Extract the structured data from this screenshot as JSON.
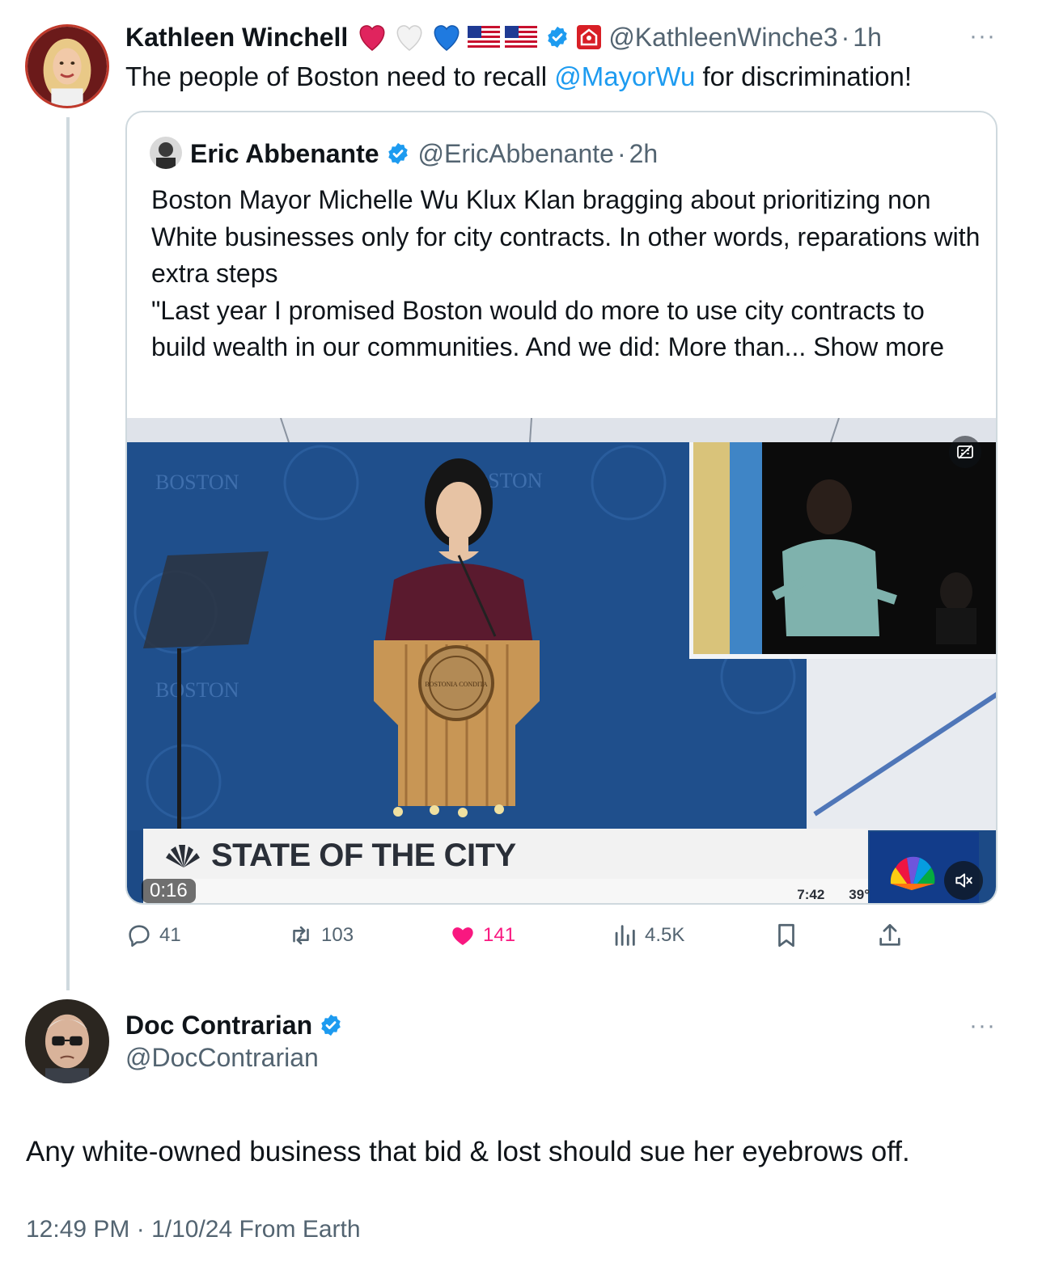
{
  "reply": {
    "name": "Kathleen Winchell",
    "handle": "@KathleenWinche3",
    "separator": "·",
    "time": "1h",
    "text_before": "The people of Boston need to recall ",
    "mention": "@MayorWu",
    "text_after": " for discrimination!",
    "more": "···"
  },
  "quote": {
    "name": "Eric Abbenante",
    "handle": "@EricAbbenante",
    "separator": "·",
    "time": "2h",
    "line1": "Boston Mayor Michelle Wu Klux Klan bragging about prioritizing non White businesses only for city contracts. In other words, reparations with extra steps",
    "line2": "\"Last year I promised Boston would do more to use city contracts to build wealth in our communities. And we did: More than...",
    "show_more": " Show more"
  },
  "video": {
    "chyron": "STATE OF THE CITY",
    "duration": "0:16",
    "clock": "7:42",
    "temperature": "39°",
    "podium_seal_text": "BOSTONIA CONDITA",
    "backdrop_text": "BOSTON"
  },
  "actions": {
    "replies": "41",
    "reposts": "103",
    "likes": "141",
    "views": "4.5K"
  },
  "main": {
    "name": "Doc Contrarian",
    "handle": "@DocContrarian",
    "text": "Any white-owned business that bid & lost should sue her eyebrows off.",
    "more": "···",
    "footer": "12:49 PM · 1/10/24 From Earth"
  },
  "colors": {
    "verified": "#1d9bf0",
    "link": "#1d9bf0",
    "like": "#f91880",
    "secondary_text": "#536471"
  }
}
